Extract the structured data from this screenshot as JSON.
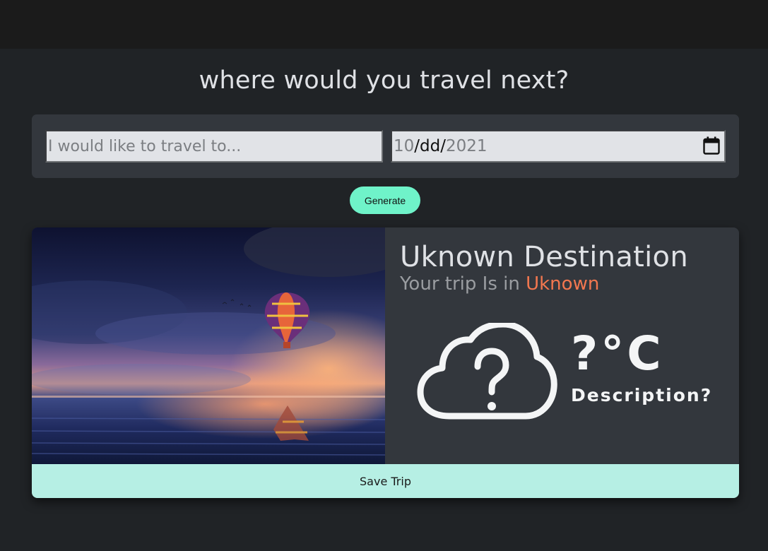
{
  "header": {
    "title": "where would you travel next?"
  },
  "form": {
    "destination_placeholder": "I would like to travel to...",
    "date": {
      "month": "10",
      "sep1": "/",
      "day": "dd",
      "sep2": "/",
      "year": "2021"
    },
    "generate_label": "Generate"
  },
  "card": {
    "title": "Uknown Destination",
    "trip_prefix": "Your trip Is in ",
    "trip_location": "Uknown",
    "temperature": "?°C",
    "description": "Description?",
    "save_label": "Save Trip"
  },
  "icons": {
    "calendar": "calendar-icon",
    "weather": "cloud-question-icon"
  },
  "colors": {
    "accent": "#6ff3c9",
    "save_bg": "#b6efe4",
    "location": "#f2774f",
    "panel": "#33373d",
    "background": "#202326"
  }
}
